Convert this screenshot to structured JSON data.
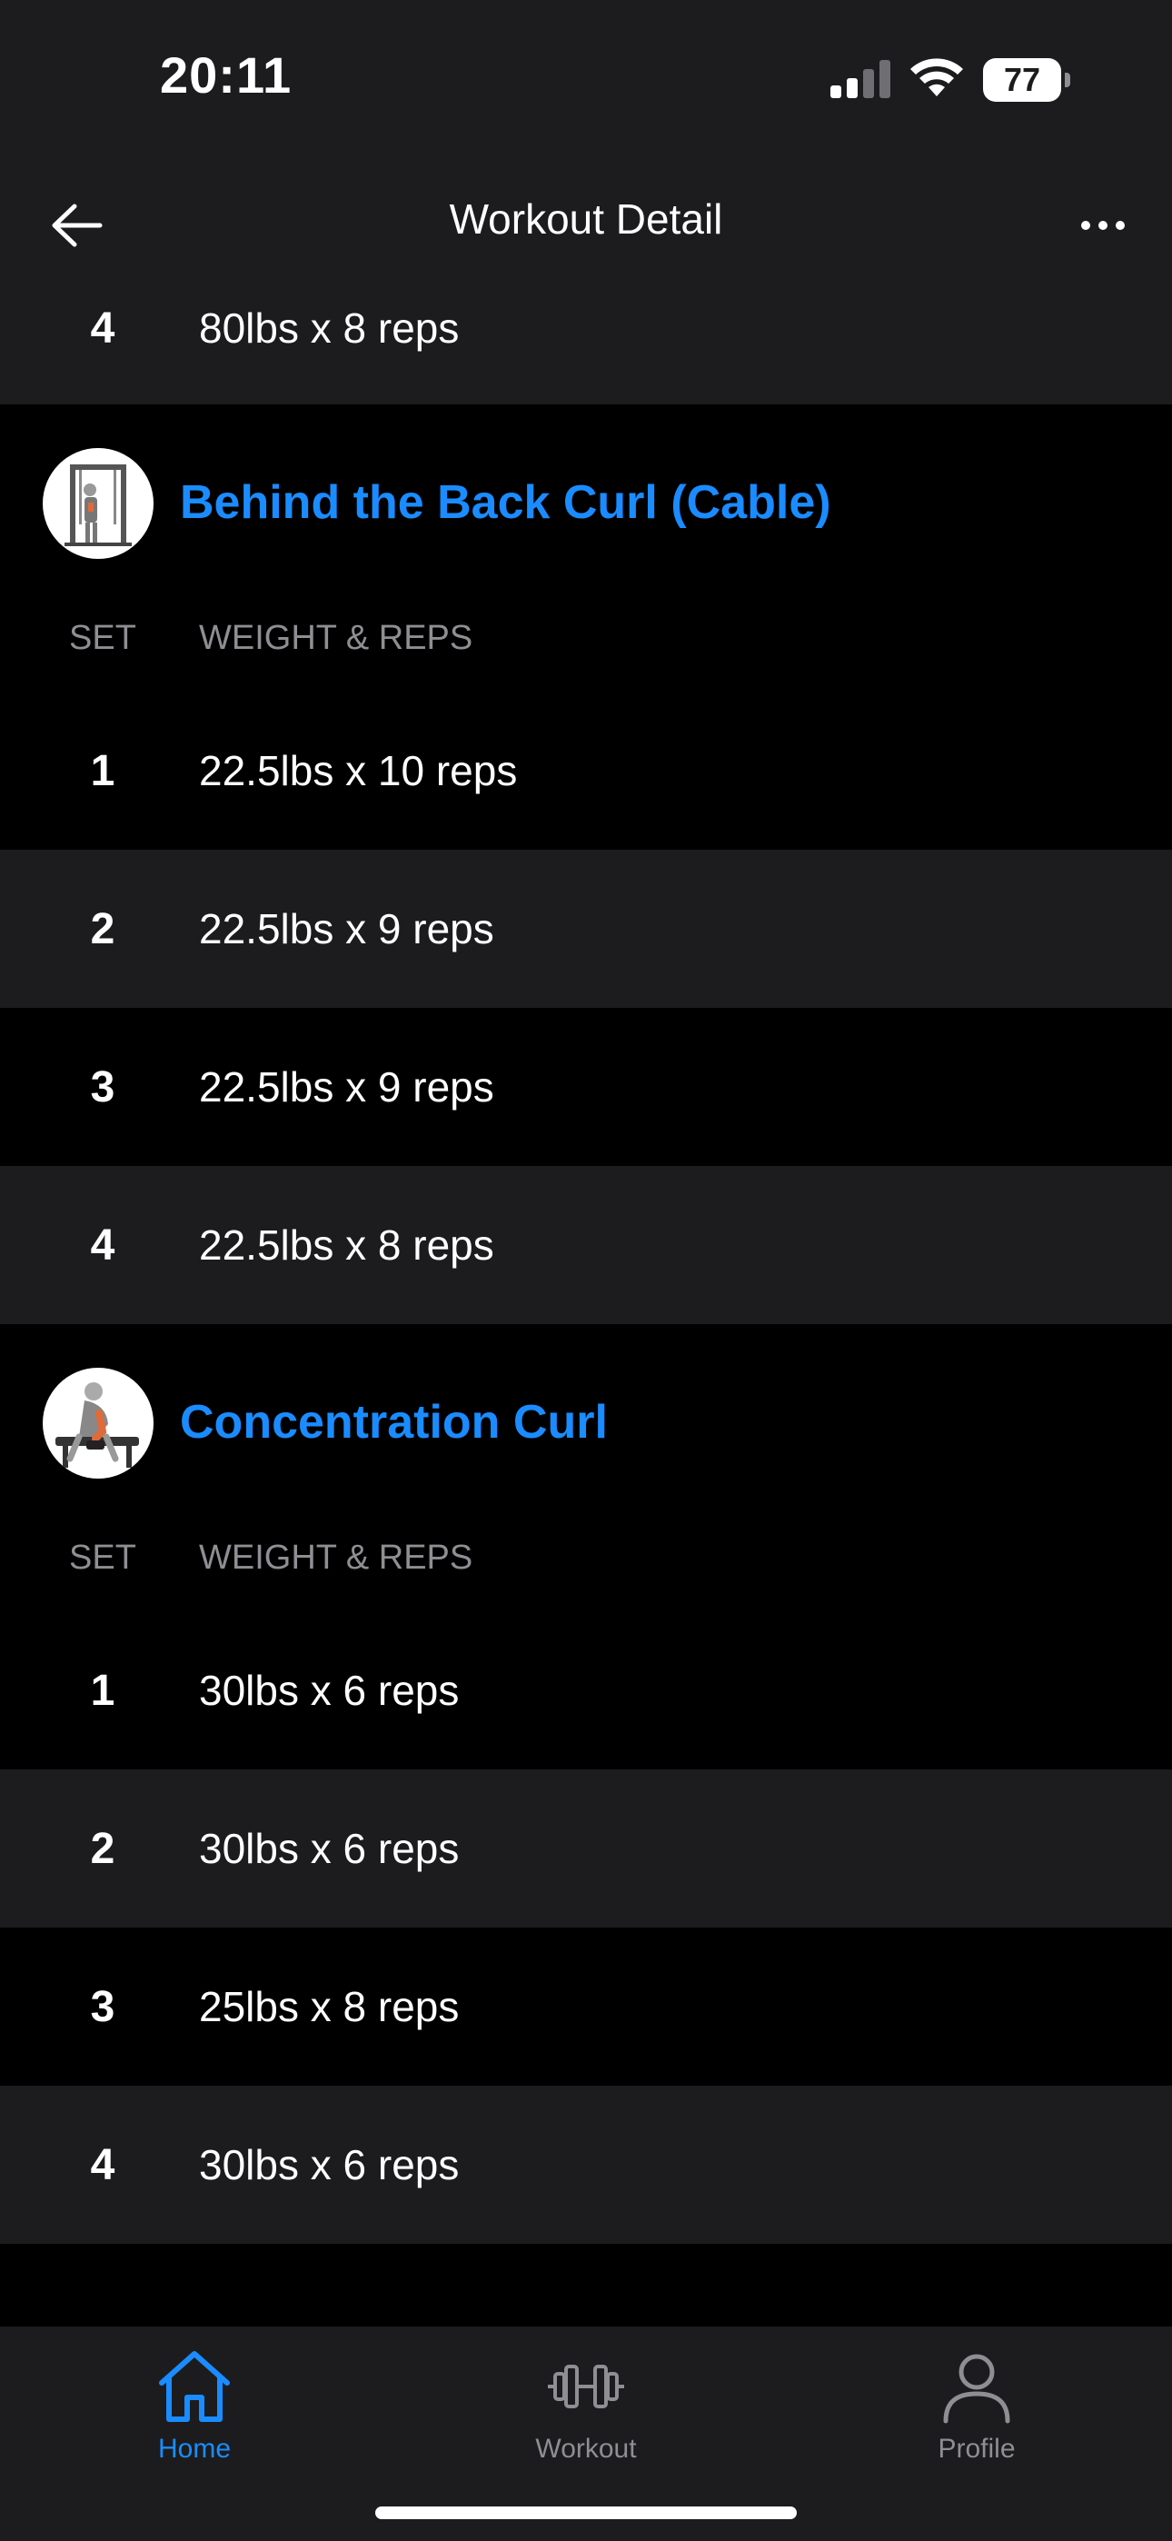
{
  "status_bar": {
    "time": "20:11",
    "battery": "77"
  },
  "header": {
    "title": "Workout Detail"
  },
  "partial_row": {
    "set": "4",
    "value": "80lbs x 8 reps"
  },
  "columns": {
    "set": "SET",
    "weight_reps": "WEIGHT & REPS"
  },
  "exercises": [
    {
      "name": "Behind the Back Curl (Cable)",
      "sets": [
        {
          "set": "1",
          "value": "22.5lbs x 10 reps"
        },
        {
          "set": "2",
          "value": "22.5lbs x 9 reps"
        },
        {
          "set": "3",
          "value": "22.5lbs x 9 reps"
        },
        {
          "set": "4",
          "value": "22.5lbs x 8 reps"
        }
      ]
    },
    {
      "name": "Concentration Curl",
      "sets": [
        {
          "set": "1",
          "value": "30lbs x 6 reps"
        },
        {
          "set": "2",
          "value": "30lbs x 6 reps"
        },
        {
          "set": "3",
          "value": "25lbs x 8 reps"
        },
        {
          "set": "4",
          "value": "30lbs x 6 reps"
        }
      ]
    }
  ],
  "tab_bar": {
    "tabs": [
      {
        "label": "Home",
        "icon": "home-icon",
        "active": true
      },
      {
        "label": "Workout",
        "icon": "dumbbell-icon",
        "active": false
      },
      {
        "label": "Profile",
        "icon": "person-icon",
        "active": false
      }
    ]
  },
  "colors": {
    "accent": "#1a8cff",
    "background": "#000000",
    "surface": "#1c1c1e",
    "muted": "#8e8e93"
  }
}
